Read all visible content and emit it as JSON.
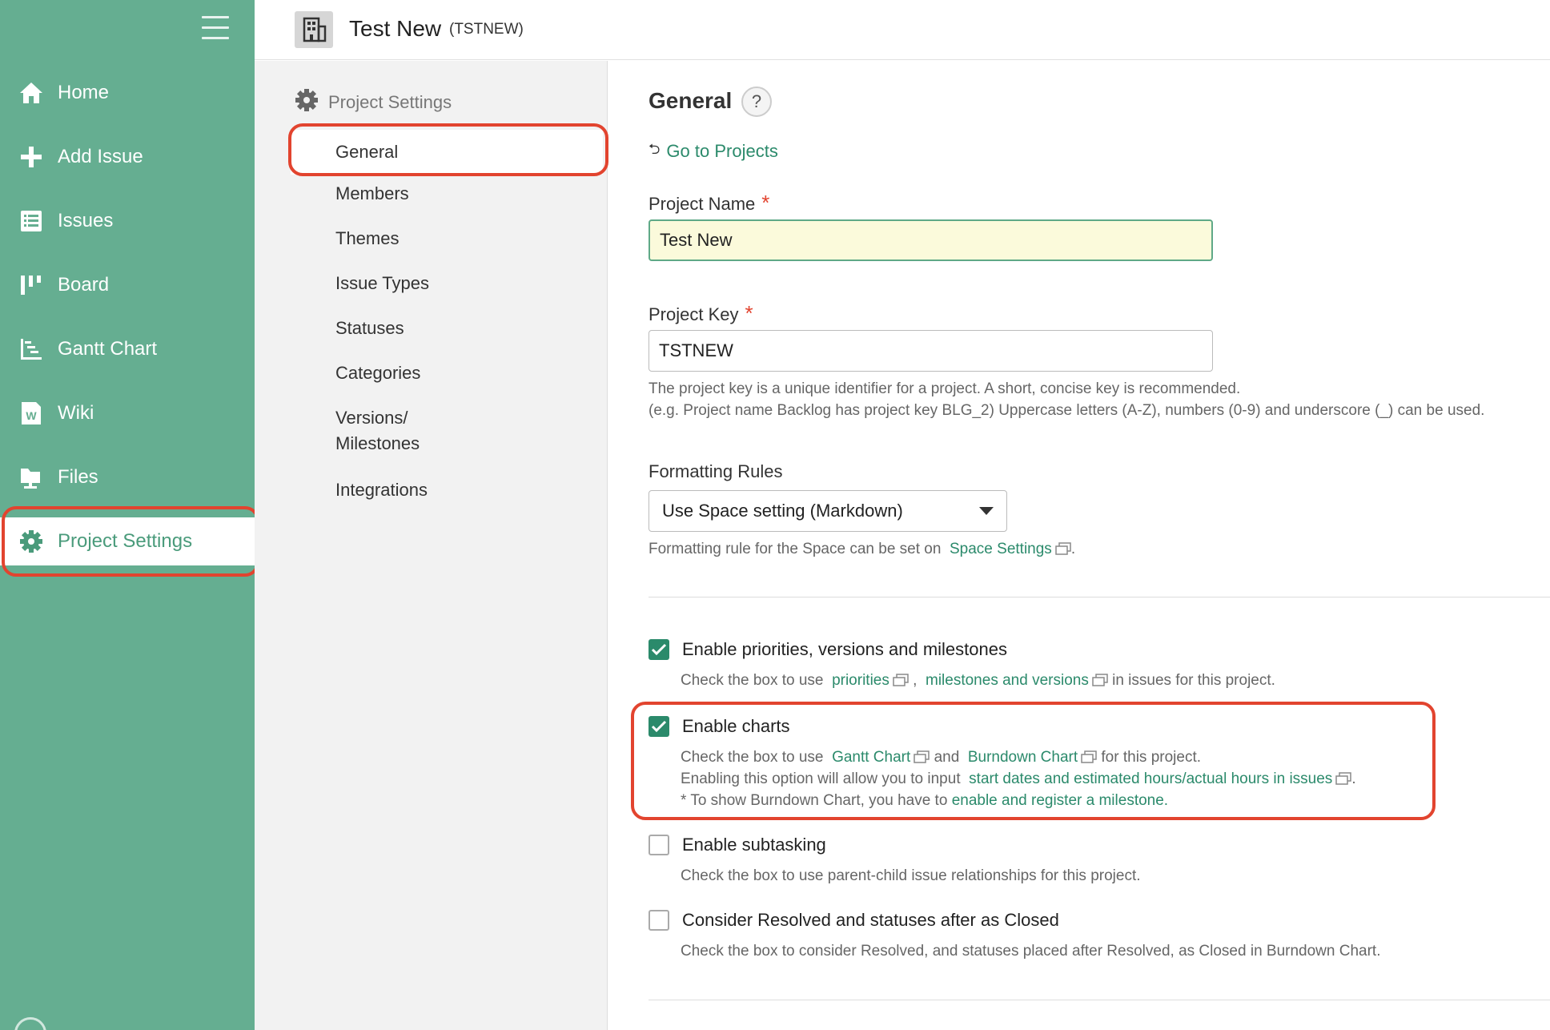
{
  "nav": {
    "items": [
      {
        "label": "Home",
        "icon": "home-icon"
      },
      {
        "label": "Add Issue",
        "icon": "plus-icon"
      },
      {
        "label": "Issues",
        "icon": "list-icon"
      },
      {
        "label": "Board",
        "icon": "board-icon"
      },
      {
        "label": "Gantt Chart",
        "icon": "gantt-icon"
      },
      {
        "label": "Wiki",
        "icon": "wiki-icon"
      },
      {
        "label": "Files",
        "icon": "files-icon"
      },
      {
        "label": "Project Settings",
        "icon": "gear-icon"
      }
    ]
  },
  "header": {
    "title": "Test New",
    "key": "(TSTNEW)"
  },
  "settings_sidebar": {
    "title": "Project Settings",
    "items": [
      "General",
      "Members",
      "Themes",
      "Issue Types",
      "Statuses",
      "Categories",
      "Versions/",
      "Milestones",
      "Integrations"
    ]
  },
  "main": {
    "title": "General",
    "help": "?",
    "back_link": "Go to Projects",
    "project_name": {
      "label": "Project Name",
      "required": "*",
      "value": "Test New"
    },
    "project_key": {
      "label": "Project Key",
      "required": "*",
      "value": "TSTNEW",
      "help1": "The project key is a unique identifier for a project. A short, concise key is recommended.",
      "help2": "(e.g. Project name Backlog has project key BLG_2) Uppercase letters (A-Z), numbers (0-9) and underscore (_) can be used."
    },
    "formatting": {
      "label": "Formatting Rules",
      "selected": "Use Space setting (Markdown)",
      "help_prefix": "Formatting rule for the Space can be set on",
      "help_link": "Space Settings",
      "help_suffix": "."
    },
    "priorities": {
      "label": "Enable priorities, versions and milestones",
      "d1": "Check the box to use",
      "l1": "priorities",
      "d2": ",",
      "l2": "milestones and versions",
      "d3": "in issues for this project."
    },
    "charts": {
      "label": "Enable charts",
      "a1": "Check the box to use",
      "al1": "Gantt Chart",
      "a2": "and",
      "al2": "Burndown Chart",
      "a3": "for this project.",
      "b1": "Enabling this option will allow you to input",
      "bl1": "start dates and estimated hours/actual hours in issues",
      "b2": ".",
      "c1": "* To show Burndown Chart, you have to",
      "cl1": "enable and register a milestone."
    },
    "subtasking": {
      "label": "Enable subtasking",
      "desc": "Check the box to use parent-child issue relationships for this project."
    },
    "resolved": {
      "label": "Consider Resolved and statuses after as Closed",
      "desc": "Check the box to consider Resolved, and statuses placed after Resolved, as Closed in Burndown Chart."
    }
  },
  "colors": {
    "nav_bg": "#65ae91",
    "accent": "#2b8a6b",
    "highlight": "#e2442f"
  }
}
